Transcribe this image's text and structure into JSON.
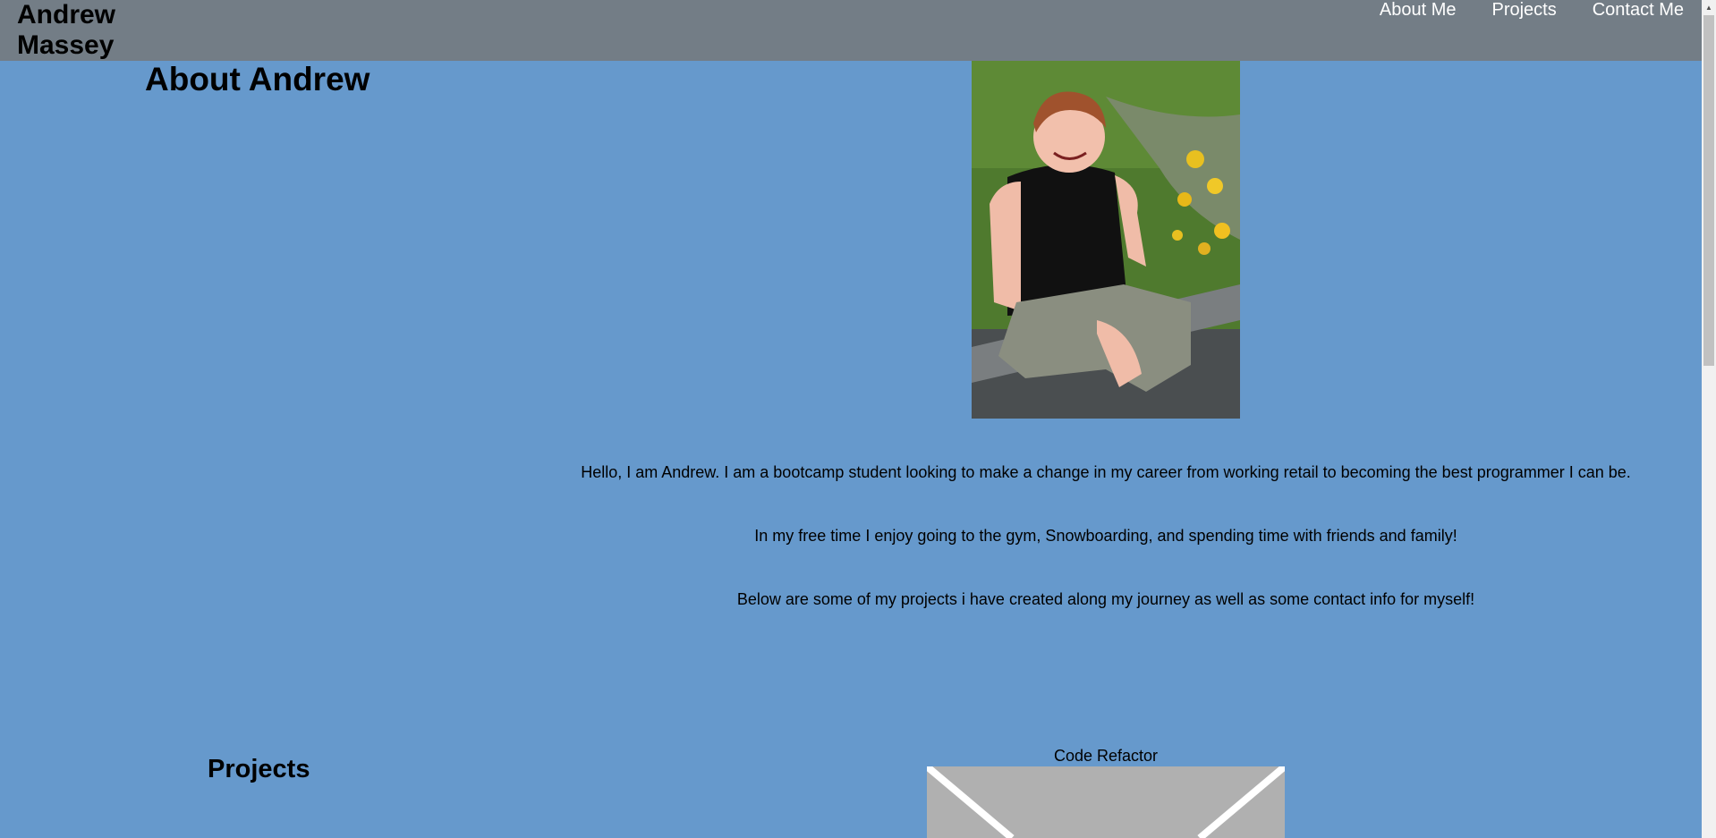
{
  "header": {
    "brand": "Andrew Massey",
    "nav": [
      "About Me",
      "Projects",
      "Contact Me"
    ]
  },
  "about": {
    "heading": "About Andrew",
    "bio": [
      "Hello, I am Andrew. I am a bootcamp student looking to make a change in my career from working retail to becoming the best programmer I can be.",
      "In my free time I enjoy going to the gym, Snowboarding, and spending time with friends and family!",
      "Below are some of my projects i have created along my journey as well as some contact info for myself!"
    ]
  },
  "projects": {
    "heading": "Projects",
    "items": [
      {
        "title": "Code Refactor"
      }
    ]
  },
  "colors": {
    "background": "#6699cc",
    "header": "#737d86",
    "nav_text": "#ffffff",
    "thumbnail_placeholder": "#b0b0b0"
  }
}
